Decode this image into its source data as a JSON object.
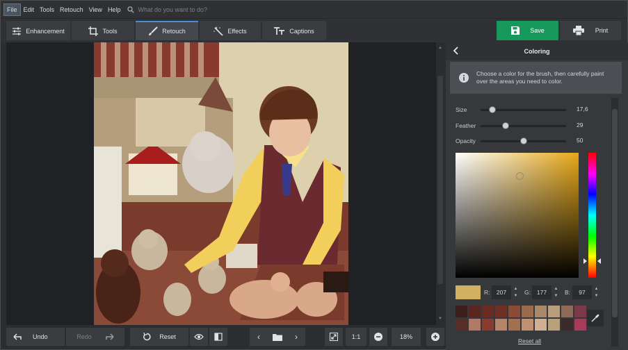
{
  "menu": {
    "items": [
      "File",
      "Edit",
      "Tools",
      "Retouch",
      "View",
      "Help"
    ],
    "search_placeholder": "What do you want to do?"
  },
  "toolbar": {
    "tabs": [
      "Enhancement",
      "Tools",
      "Retouch",
      "Effects",
      "Captions"
    ],
    "active_tab": "Retouch",
    "save_label": "Save",
    "print_label": "Print"
  },
  "bottom": {
    "undo_label": "Undo",
    "redo_label": "Redo",
    "reset_label": "Reset",
    "one_to_one": "1:1",
    "zoom": "18%"
  },
  "panel": {
    "title": "Coloring",
    "info_text": "Choose a color for the brush, then carefully paint over the areas you need to color.",
    "sliders": [
      {
        "label": "Size",
        "value": "17,6",
        "fraction": 0.14
      },
      {
        "label": "Feather",
        "value": "29",
        "fraction": 0.29
      },
      {
        "label": "Opacity",
        "value": "50",
        "fraction": 0.5
      }
    ],
    "color": {
      "hex": "#cfb161",
      "r": "207",
      "g": "177",
      "b": "97"
    },
    "rgb_labels": {
      "r": "R:",
      "g": "G:",
      "b": "B:"
    },
    "palette": [
      "#3b1e1a",
      "#5a2620",
      "#6b2a22",
      "#6e3024",
      "#8a4a36",
      "#9a6a4c",
      "#a8896a",
      "#b89e7e",
      "#8f6a58",
      "#7a3a4a",
      "#5a2e28",
      "#b07a66",
      "#8a3a2e",
      "#b5856a",
      "#a07050",
      "#c09070",
      "#d0b090",
      "#b8a07a",
      "#3a2a2a",
      "#a83a5a"
    ],
    "reset_all_label": "Reset all"
  },
  "colors": {
    "accent_blue": "#4b8fd6",
    "save_green": "#17995b"
  }
}
